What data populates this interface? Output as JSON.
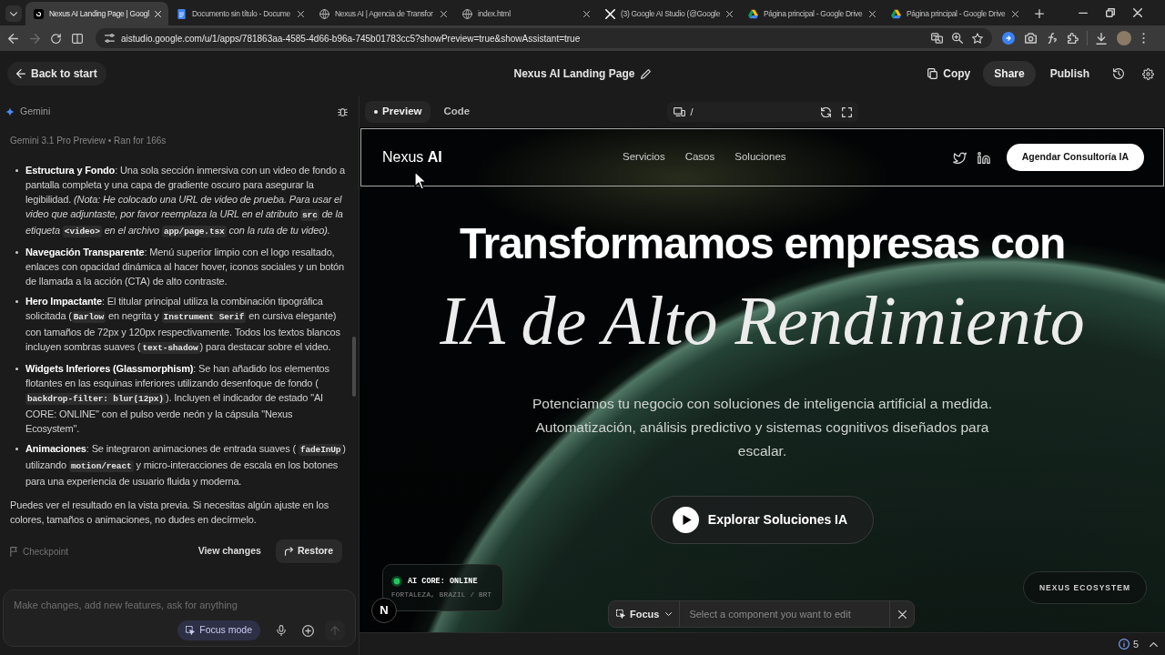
{
  "browser": {
    "tabs": [
      {
        "title": "Nexus AI Landing Page | Googl",
        "kind": "app",
        "selected": true
      },
      {
        "title": "Documento sin título - Docume",
        "kind": "doc",
        "selected": false
      },
      {
        "title": "Nexus AI | Agencia de Transfor",
        "kind": "web",
        "selected": false
      },
      {
        "title": "index.html",
        "kind": "web",
        "selected": false
      },
      {
        "title": "(3) Google AI Studio (@Google",
        "kind": "social",
        "selected": false
      },
      {
        "title": "Página principal - Google Drive",
        "kind": "storage",
        "selected": false
      },
      {
        "title": "Página principal - Google Drive",
        "kind": "storage",
        "selected": false
      }
    ],
    "forward_disabled": true,
    "address": "aistudio.google.com/u/1/apps/781863aa-4585-4d66-b96a-745b01783cc5?showPreview=true&showAssistant=true"
  },
  "header": {
    "back": "Back to start",
    "title": "Nexus AI Landing Page",
    "actions": [
      {
        "label": "Copy",
        "kind": "copy"
      },
      {
        "label": "Share",
        "kind": "filled"
      },
      {
        "label": "Publish",
        "kind": "plain"
      }
    ]
  },
  "chat": {
    "assistant": "Gemini",
    "meta": "Gemini 3.1 Pro Preview • Ran for 166s",
    "bullets": [
      {
        "segments": [
          {
            "kind": "text",
            "text": "**Estructura y Fondo**: Una sola sección inmersiva con un video de fondo a pantalla completa y una capa de gradiente oscuro para asegurar la legibilidad. *(Nota: He colocado una URL de video de prueba. Para usar el video que adjuntaste, por favor reemplaza la URL en el atributo* "
          },
          {
            "kind": "code",
            "text": "src"
          },
          {
            "kind": "text",
            "text": " *de la etiqueta* "
          },
          {
            "kind": "code",
            "text": "<video>"
          },
          {
            "kind": "text",
            "text": " *en el archivo* "
          },
          {
            "kind": "code",
            "text": "app/page.tsx"
          },
          {
            "kind": "text",
            "text": " *con la ruta de tu video).*"
          }
        ]
      },
      {
        "segments": [
          {
            "kind": "text",
            "text": "**Navegación Transparente**: Menú superior limpio con el logo resaltado, enlaces con opacidad dinámica al hacer hover, iconos sociales y un botón de llamada a la acción (CTA) de alto contraste."
          }
        ]
      },
      {
        "segments": [
          {
            "kind": "text",
            "text": "**Hero Impactante**: El titular principal utiliza la combinación tipográfica solicitada ("
          },
          {
            "kind": "code",
            "text": "Barlow"
          },
          {
            "kind": "text",
            "text": " en negrita y "
          },
          {
            "kind": "code",
            "text": "Instrument Serif"
          },
          {
            "kind": "text",
            "text": " en cursiva elegante) con tamaños de 72px y 120px respectivamente. Todos los textos blancos incluyen sombras suaves ("
          },
          {
            "kind": "code",
            "text": "text-shadow"
          },
          {
            "kind": "text",
            "text": ") para destacar sobre el video."
          }
        ]
      },
      {
        "segments": [
          {
            "kind": "text",
            "text": "**Widgets Inferiores (Glassmorphism)**: Se han añadido los elementos flotantes en las esquinas inferiores utilizando desenfoque de fondo ( "
          },
          {
            "kind": "code",
            "text": "backdrop-filter: blur(12px)"
          },
          {
            "kind": "text",
            "text": "). Incluyen el indicador de estado \"AI CORE: ONLINE\" con el pulso verde neón y la cápsula \"Nexus Ecosystem\"."
          }
        ]
      },
      {
        "segments": [
          {
            "kind": "text",
            "text": "**Animaciones**: Se integraron animaciones de entrada suaves ( "
          },
          {
            "kind": "code",
            "text": "fadeInUp"
          },
          {
            "kind": "text",
            "text": ") utilizando "
          },
          {
            "kind": "code",
            "text": "motion/react"
          },
          {
            "kind": "text",
            "text": " y micro-interacciones de escala en los botones para una experiencia de usuario fluida y moderna."
          }
        ]
      }
    ],
    "closing": "Puedes ver el resultado en la vista previa. Si necesitas algún ajuste en los colores, tamaños o animaciones, no dudes en decírmelo.",
    "checkpoint": "Checkpoint",
    "view_changes": "View changes",
    "restore": "Restore",
    "input": {
      "placeholder": "Make changes, add new features, ask for anything"
    },
    "focus_mode": "Focus mode",
    "send_disabled": true
  },
  "workspace": {
    "tabs": [
      {
        "label": "Preview",
        "selected": true
      },
      {
        "label": "Code",
        "selected": false
      }
    ],
    "path": "/",
    "site": {
      "outlined": true,
      "logo": "Nexus **AI**",
      "links": [
        "Servicios",
        "Casos",
        "Soluciones"
      ],
      "cta": "Agendar Consultoría IA",
      "headline": "Transformamos empresas con",
      "accent": "IA de Alto Rendimiento",
      "subtitle": "Potenciamos tu negocio con soluciones de inteligencia artificial a medida. Automatización, análisis predictivo y sistemas cognitivos diseñados para escalar.",
      "hero_button": "Explorar Soluciones IA",
      "status_widget": {
        "title": "AI CORE: ONLINE",
        "location": "FORTALEZA, BRAZIL / BRT",
        "online": true
      },
      "ecosystem": "NEXUS ECOSYSTEM",
      "dev_badge": "N"
    },
    "focus_bar": {
      "mode": "Focus",
      "placeholder": "Select a component you want to edit"
    },
    "issues": "5"
  }
}
